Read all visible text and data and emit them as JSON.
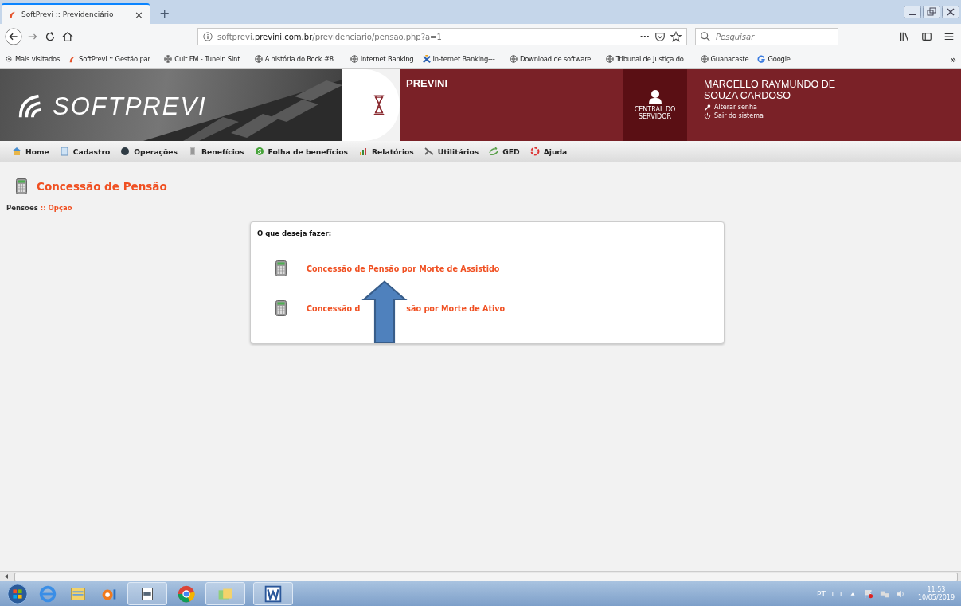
{
  "browser": {
    "tab": {
      "title": "SoftPrevi :: Previdenciário",
      "close": "×",
      "selected": true
    },
    "new_tab": "+",
    "url": {
      "prefix": "softprevi.",
      "domain": "previni.com.br",
      "path": "/previdenciario/pensao.php?a=1"
    },
    "page_actions": "···",
    "search": {
      "placeholder": "Pesquisar"
    },
    "bookmarks": [
      "Mais visitados",
      "SoftPrevi :: Gestão par...",
      "Cult FM - TuneIn Sint...",
      "A história do Rock #8 ...",
      "Internet Banking",
      "In-ternet Banking---...",
      "Download de software...",
      "Tribunal de Justiça do ...",
      "Guanacaste",
      "Google"
    ],
    "overflow": "»"
  },
  "header": {
    "logo": "SOFTPREVI",
    "entity": "PREVINI",
    "central": "CENTRAL DO SERVIDOR",
    "user": "MARCELLO RAYMUNDO DE SOUZA CARDOSO",
    "change_password": "Alterar senha",
    "logout": "Sair do sistema"
  },
  "menu": [
    "Home",
    "Cadastro",
    "Operações",
    "Benefícios",
    "Folha de benefícios",
    "Relatórios",
    "Utilitários",
    "GED",
    "Ajuda"
  ],
  "page": {
    "title": "Concessão de Pensão",
    "breadcrumb": [
      "Pensões",
      "Opção"
    ],
    "separator": "::"
  },
  "card": {
    "heading": "O que deseja fazer:",
    "options": [
      {
        "parts": [
          "Concessão de Pensão por Morte de Assistido"
        ]
      },
      {
        "parts": [
          "Concessão d",
          "são por Morte de Ativo"
        ]
      }
    ]
  },
  "taskbar": {
    "language": "PT",
    "time": "11:53",
    "date": "10/05/2019"
  }
}
